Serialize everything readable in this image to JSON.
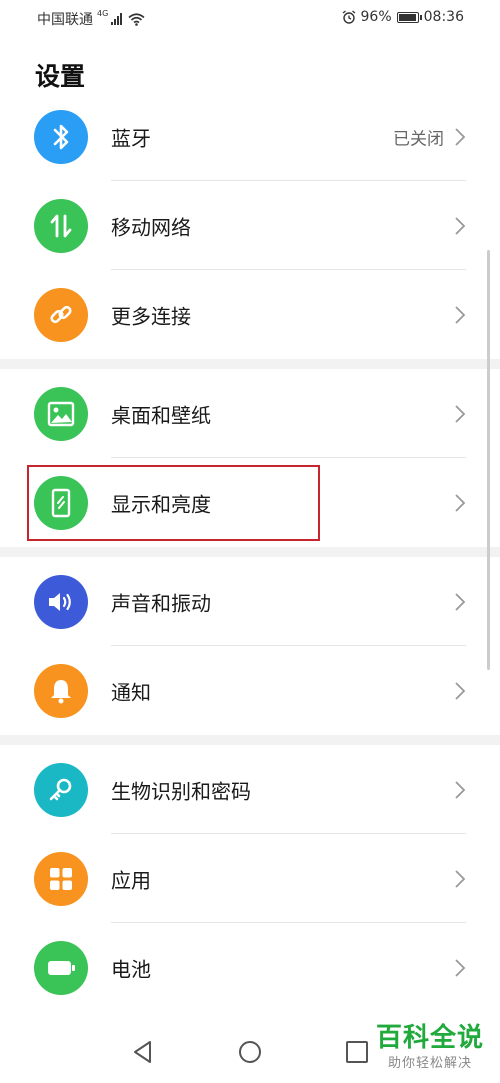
{
  "status_bar": {
    "carrier": "中国联通",
    "network": "4G",
    "battery": "96%",
    "battery_level": 0.96,
    "time": "08:36",
    "icons": [
      "signal-icon",
      "wifi-icon",
      "alarm-icon",
      "battery-icon"
    ]
  },
  "title": "设置",
  "items": [
    {
      "label": "蓝牙",
      "value": "已关闭",
      "icon": "bluetooth-icon",
      "color": "#2a9df4"
    },
    {
      "label": "移动网络",
      "icon": "mobile-data-icon",
      "color": "#3ac357"
    },
    {
      "label": "更多连接",
      "icon": "link-icon",
      "color": "#f7931e"
    },
    {
      "label": "桌面和壁纸",
      "icon": "wallpaper-icon",
      "color": "#3ac357"
    },
    {
      "label": "显示和亮度",
      "icon": "display-icon",
      "color": "#3ac357"
    },
    {
      "label": "声音和振动",
      "icon": "sound-icon",
      "color": "#3d5bd9"
    },
    {
      "label": "通知",
      "icon": "bell-icon",
      "color": "#f7931e"
    },
    {
      "label": "生物识别和密码",
      "icon": "key-icon",
      "color": "#1ab8c4"
    },
    {
      "label": "应用",
      "icon": "apps-icon",
      "color": "#f7931e"
    },
    {
      "label": "电池",
      "icon": "battery-setting-icon",
      "color": "#3ac357"
    }
  ],
  "highlight_color": "#c8262e",
  "navbar": {
    "icons": [
      "back-icon",
      "home-icon",
      "recents-icon"
    ]
  },
  "watermark": {
    "title": "百科全说",
    "subtitle": "助你轻松解决"
  }
}
